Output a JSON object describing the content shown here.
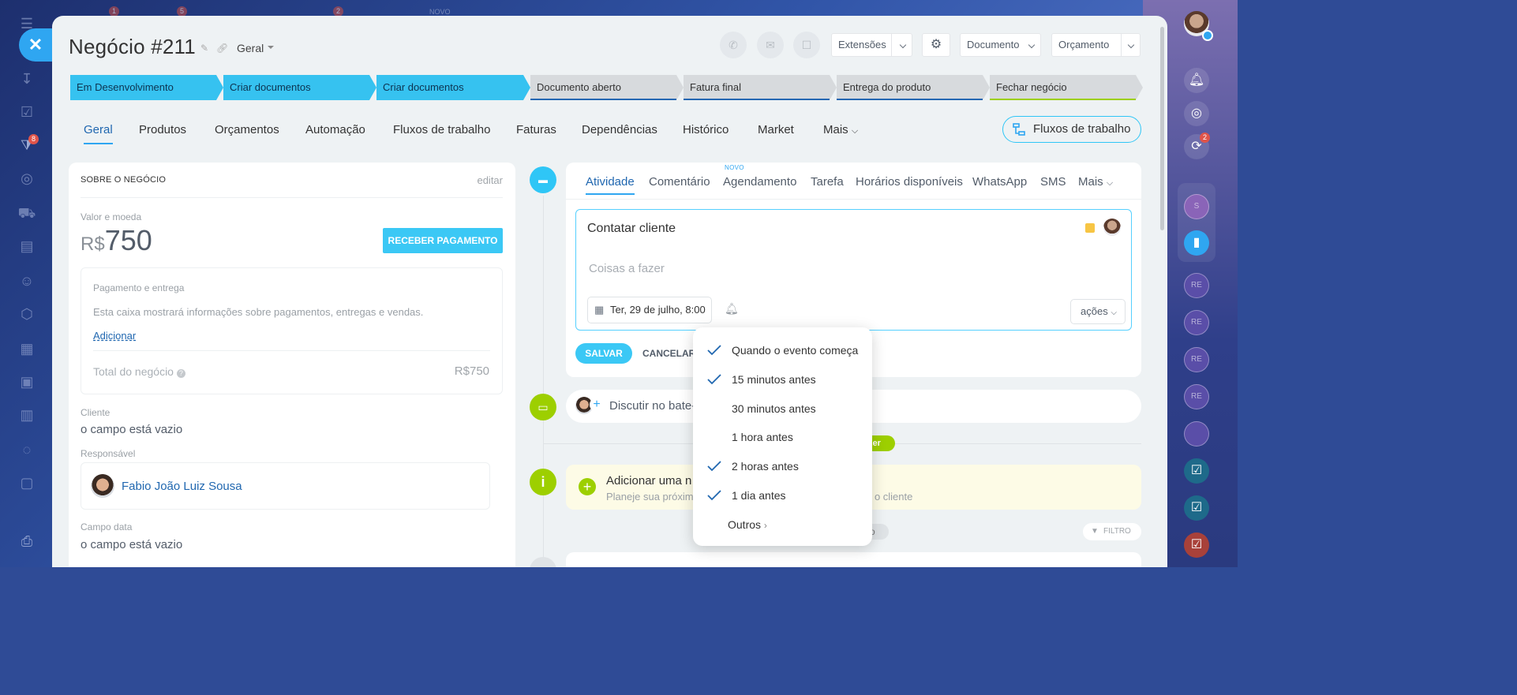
{
  "sidebar_left": {
    "badge": "8"
  },
  "top_ghost": {
    "badge1": "1",
    "badge2": "5",
    "badge3": "2",
    "novo": "NOVO"
  },
  "right_sidebar": {
    "notif_badge": "2",
    "avatars": [
      "S",
      "RE",
      "RE",
      "RE",
      "RE"
    ]
  },
  "header": {
    "title": "Negócio #211",
    "pipeline": "Geral",
    "extensions": "Extensões",
    "document": "Documento",
    "budget": "Orçamento"
  },
  "stages": [
    {
      "label": "Em Desenvolvimento",
      "active": true
    },
    {
      "label": "Criar documentos",
      "active": true
    },
    {
      "label": "Criar documentos",
      "active": true
    },
    {
      "label": "Documento aberto",
      "active": false
    },
    {
      "label": "Fatura final",
      "active": false
    },
    {
      "label": "Entrega do produto",
      "active": false
    },
    {
      "label": "Fechar negócio",
      "active": false
    }
  ],
  "tabs": [
    "Geral",
    "Produtos",
    "Orçamentos",
    "Automação",
    "Fluxos de trabalho",
    "Faturas",
    "Dependências",
    "Histórico",
    "Market",
    "Mais"
  ],
  "workflow_button": "Fluxos de trabalho",
  "about": {
    "heading": "SOBRE O NEGÓCIO",
    "edit": "editar",
    "amount_label": "Valor e moeda",
    "currency": "R$",
    "amount": "750",
    "receive_payment": "RECEBER PAGAMENTO",
    "payment_title": "Pagamento e entrega",
    "payment_desc": "Esta caixa mostrará informações sobre pagamentos, entregas e vendas.",
    "add": "Adicionar",
    "total_label": "Total do negócio",
    "total_value": "R$750",
    "client_label": "Cliente",
    "client_value": "o campo está vazio",
    "responsible_label": "Responsável",
    "responsible_name": "Fabio João Luiz Sousa",
    "date_label": "Campo data",
    "date_value": "o campo está vazio"
  },
  "activity": {
    "tabs": [
      "Atividade",
      "Comentário",
      "Agendamento",
      "Tarefa",
      "Horários disponíveis",
      "WhatsApp",
      "SMS",
      "Mais"
    ],
    "new_badge": "NOVO",
    "task_title": "Contatar cliente",
    "todo_placeholder": "Coisas a fazer",
    "date": "Ter, 29 de julho, 8:00",
    "actions": "ações",
    "save": "SALVAR",
    "cancel": "CANCELAR",
    "chat_discuss": "Discutir no bate-",
    "green_pill": "zer",
    "add_title": "Adicionar uma n",
    "add_desc_left": "Planeje sua próxim",
    "add_desc_right": "r o cliente",
    "grey_pill": "o",
    "filter": "FILTRO"
  },
  "reminder_menu": {
    "items": [
      {
        "label": "Quando o evento começa",
        "checked": true
      },
      {
        "label": "15 minutos antes",
        "checked": true
      },
      {
        "label": "30 minutos antes",
        "checked": false
      },
      {
        "label": "1 hora antes",
        "checked": false
      },
      {
        "label": "2 horas antes",
        "checked": true
      },
      {
        "label": "1 dia antes",
        "checked": true
      }
    ],
    "others": "Outros"
  },
  "colors": {
    "accent": "#2fc6f6",
    "stage_active": "#36c2f0",
    "link": "#2067b0",
    "green": "#9dcf00"
  }
}
